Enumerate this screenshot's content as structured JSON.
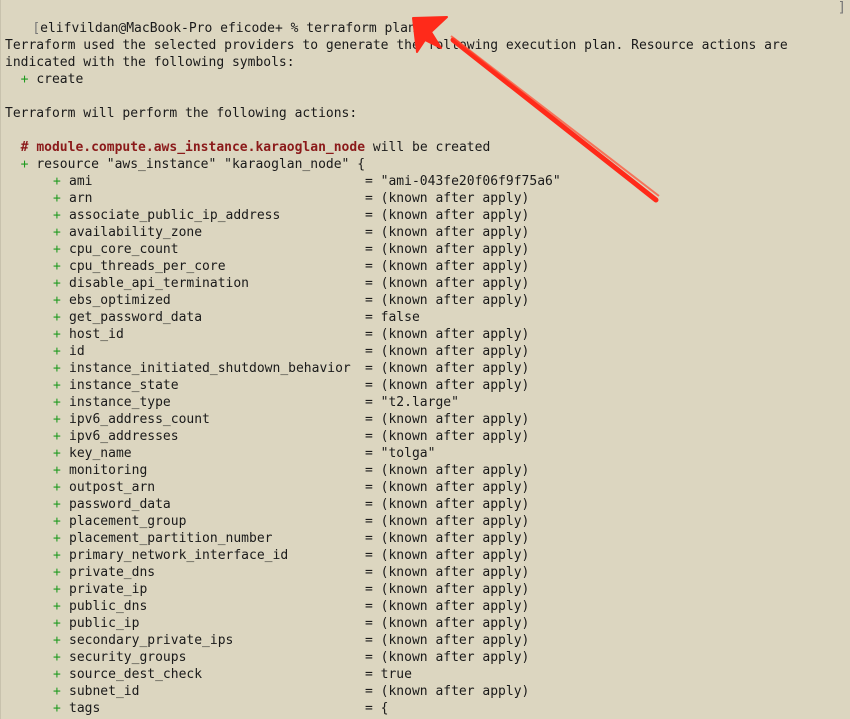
{
  "prompt": {
    "user_host": "elifvildan@MacBook-Pro",
    "dir": "eficode+",
    "symbol": "%",
    "command": "terraform plan"
  },
  "intro": {
    "line1": "Terraform used the selected providers to generate the following execution plan. Resource actions are",
    "line2": "indicated with the following symbols:",
    "symbol_create": "+",
    "symbol_create_label": "create"
  },
  "actions_heading": "Terraform will perform the following actions:",
  "resource": {
    "comment_hash": "#",
    "module_name": "module.compute.aws_instance.karaoglan_node",
    "will_be": "will be created",
    "plus": "+",
    "declaration": "resource \"aws_instance\" \"karaoglan_node\" {"
  },
  "attributes": [
    {
      "name": "ami",
      "value": "\"ami-043fe20f06f9f75a6\""
    },
    {
      "name": "arn",
      "value": "(known after apply)"
    },
    {
      "name": "associate_public_ip_address",
      "value": "(known after apply)"
    },
    {
      "name": "availability_zone",
      "value": "(known after apply)"
    },
    {
      "name": "cpu_core_count",
      "value": "(known after apply)"
    },
    {
      "name": "cpu_threads_per_core",
      "value": "(known after apply)"
    },
    {
      "name": "disable_api_termination",
      "value": "(known after apply)"
    },
    {
      "name": "ebs_optimized",
      "value": "(known after apply)"
    },
    {
      "name": "get_password_data",
      "value": "false"
    },
    {
      "name": "host_id",
      "value": "(known after apply)"
    },
    {
      "name": "id",
      "value": "(known after apply)"
    },
    {
      "name": "instance_initiated_shutdown_behavior",
      "value": "(known after apply)"
    },
    {
      "name": "instance_state",
      "value": "(known after apply)"
    },
    {
      "name": "instance_type",
      "value": "\"t2.large\""
    },
    {
      "name": "ipv6_address_count",
      "value": "(known after apply)"
    },
    {
      "name": "ipv6_addresses",
      "value": "(known after apply)"
    },
    {
      "name": "key_name",
      "value": "\"tolga\""
    },
    {
      "name": "monitoring",
      "value": "(known after apply)"
    },
    {
      "name": "outpost_arn",
      "value": "(known after apply)"
    },
    {
      "name": "password_data",
      "value": "(known after apply)"
    },
    {
      "name": "placement_group",
      "value": "(known after apply)"
    },
    {
      "name": "placement_partition_number",
      "value": "(known after apply)"
    },
    {
      "name": "primary_network_interface_id",
      "value": "(known after apply)"
    },
    {
      "name": "private_dns",
      "value": "(known after apply)"
    },
    {
      "name": "private_ip",
      "value": "(known after apply)"
    },
    {
      "name": "public_dns",
      "value": "(known after apply)"
    },
    {
      "name": "public_ip",
      "value": "(known after apply)"
    },
    {
      "name": "secondary_private_ips",
      "value": "(known after apply)"
    },
    {
      "name": "security_groups",
      "value": "(known after apply)"
    },
    {
      "name": "source_dest_check",
      "value": "true"
    },
    {
      "name": "subnet_id",
      "value": "(known after apply)"
    },
    {
      "name": "tags",
      "value": "{"
    }
  ],
  "attr_plus": "+",
  "attr_eq": "=",
  "colors": {
    "background": "#dcd6c0",
    "plus_green": "#1f9a1f",
    "module_red": "#8b1a1a",
    "annotation_arrow": "#ff2a1a"
  },
  "annotation": {
    "icon": "red-arrow-annotation"
  }
}
